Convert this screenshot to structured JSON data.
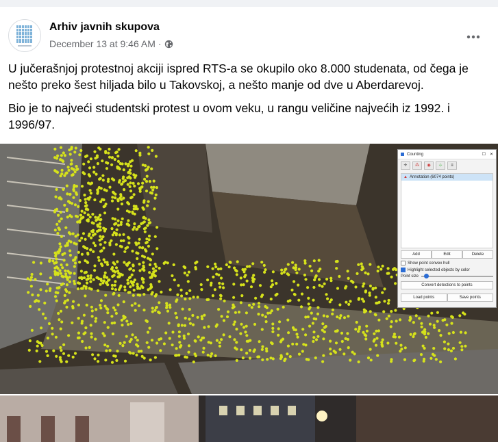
{
  "post": {
    "author": "Arhiv javnih skupova",
    "timestamp": "December 13 at 9:46 AM",
    "separator": "·",
    "paragraphs": [
      "U jučerašnjoj protestnoj akciji ispred RTS-a se okupilo oko 8.000 studenata, od čega je nešto preko šest hiljada bilo u Takovskoj, a nešto manje od dve u Aberdarevoj.",
      "Bio je to najveći studentski protest u ovom veku, u rangu veličine najvećih iz 1992. i 1996/97."
    ],
    "more_icon": "more-horizontal-icon",
    "privacy_icon": "globe-icon"
  },
  "counting_window": {
    "title": "Counting",
    "annotation_label": "Annotation (6074 points)",
    "buttons": [
      "Add",
      "Edit",
      "Delete"
    ],
    "checkboxes": [
      {
        "label": "Show point convex hull",
        "checked": false
      },
      {
        "label": "Highlight selected objects by color",
        "checked": true
      }
    ],
    "point_size_label": "Point size",
    "point_size_value": 0.05,
    "convert_label": "Convert detections to points",
    "load_label": "Load points",
    "save_label": "Save points"
  },
  "colors": {
    "accent": "#1877f2",
    "crowd_marker": "#d6e21b",
    "text": "#050505",
    "meta": "#65676b"
  }
}
